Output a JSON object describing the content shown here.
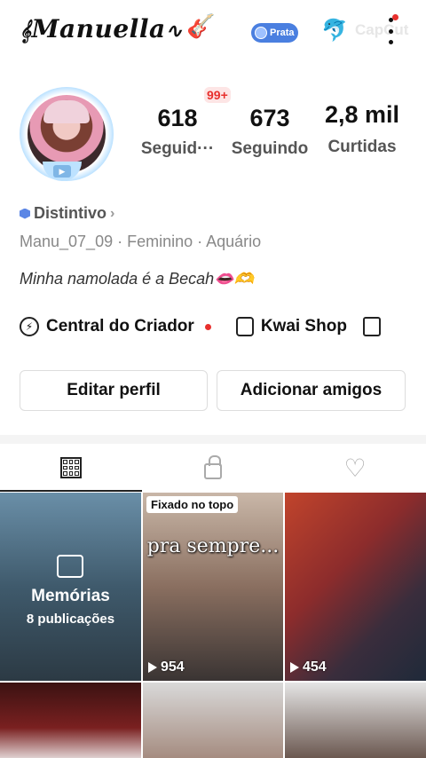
{
  "header": {
    "profile_name": "Manuella",
    "guitar_icon": "guitar-icon",
    "tier_label": "Prata",
    "watermark": "CapCut"
  },
  "profile": {
    "notification_badge": "99+",
    "stats": [
      {
        "value": "618",
        "label": "Seguid···"
      },
      {
        "value": "673",
        "label": "Seguindo"
      },
      {
        "value": "2,8 mil",
        "label": "Curtidas"
      }
    ],
    "badge_label": "Distintivo",
    "info_line": "Manu_07_09 · Feminino · Aquário",
    "bio": "Minha namolada é a Becah👄🫶"
  },
  "quick_links": {
    "creator": "Central do Criador",
    "shop": "Kwai Shop"
  },
  "buttons": {
    "edit": "Editar perfil",
    "add_friends": "Adicionar amigos"
  },
  "grid": {
    "memories_title": "Memórias",
    "memories_count": "8 publicações",
    "pinned_label": "Fixado no topo",
    "pinned_caption": "pra sempre...",
    "video1_views": "954",
    "video2_views": "454"
  }
}
